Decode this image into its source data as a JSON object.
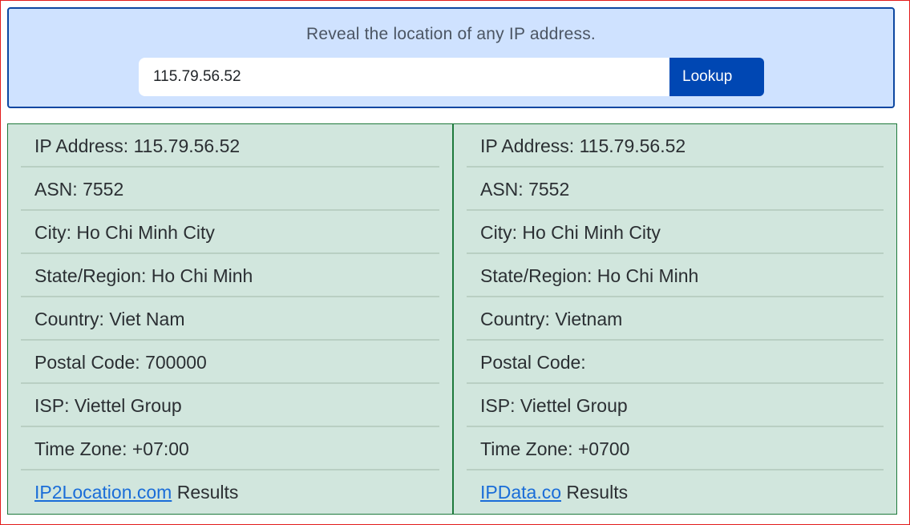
{
  "search": {
    "tagline": "Reveal the location of any IP address.",
    "ip_value": "115.79.56.52",
    "lookup_label": "Lookup"
  },
  "left": {
    "ip": "IP Address: 115.79.56.52",
    "asn": "ASN: 7552",
    "city": "City: Ho Chi Minh City",
    "region": "State/Region: Ho Chi Minh",
    "country": "Country: Viet Nam",
    "postal": "Postal Code: 700000",
    "isp": "ISP: Viettel Group",
    "timezone": "Time Zone: +07:00",
    "source_link": "IP2Location.com",
    "source_suffix": " Results"
  },
  "right": {
    "ip": "IP Address: 115.79.56.52",
    "asn": "ASN: 7552",
    "city": "City: Ho Chi Minh City",
    "region": "State/Region: Ho Chi Minh",
    "country": "Country: Vietnam",
    "postal": "Postal Code:",
    "isp": "ISP: Viettel Group",
    "timezone": "Time Zone: +0700",
    "source_link": "IPData.co",
    "source_suffix": " Results"
  },
  "colors": {
    "search_bg": "#cfe2ff",
    "button": "#0047b3",
    "results_bg": "#d1e6dd",
    "results_border": "#1e7a3c",
    "link": "#1a6dd8"
  }
}
